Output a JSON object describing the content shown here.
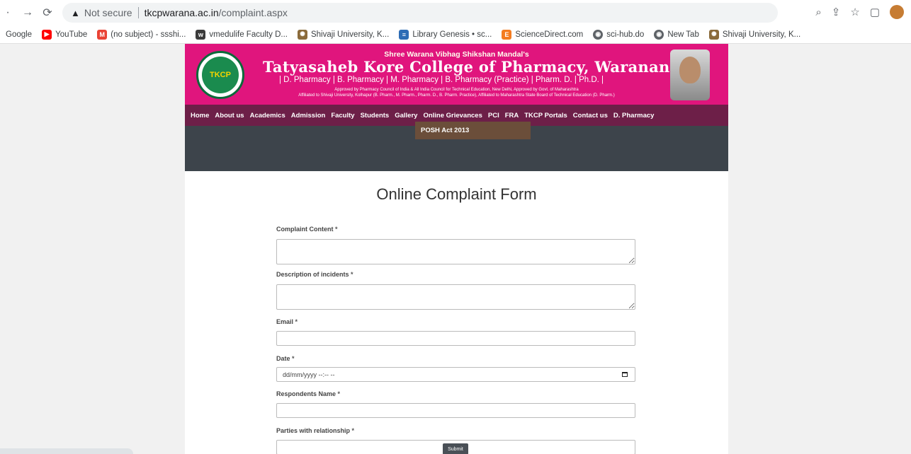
{
  "browser": {
    "not_secure": "Not secure",
    "url_host": "tkcpwarana.ac.in",
    "url_path": "/complaint.aspx"
  },
  "bookmarks": [
    {
      "label": "Google",
      "icon": "google-icon",
      "color": "#4285f4"
    },
    {
      "label": "YouTube",
      "icon": "youtube-icon",
      "color": "#ff0000"
    },
    {
      "label": "(no subject) - ssshi...",
      "icon": "gmail-icon",
      "color": "#ea4335"
    },
    {
      "label": "vmedulife Faculty D...",
      "icon": "vmedulife-icon",
      "color": "#3b3b3b"
    },
    {
      "label": "Shivaji University, K...",
      "icon": "university-icon",
      "color": "#8b6b3b"
    },
    {
      "label": "Library Genesis • sc...",
      "icon": "library-icon",
      "color": "#2d6cb5"
    },
    {
      "label": "ScienceDirect.com",
      "icon": "sciencedirect-icon",
      "color": "#f47c20"
    },
    {
      "label": "sci-hub.do",
      "icon": "globe-icon",
      "color": "#5f6368"
    },
    {
      "label": "New Tab",
      "icon": "globe-icon",
      "color": "#5f6368"
    },
    {
      "label": "Shivaji University, K...",
      "icon": "university-icon",
      "color": "#8b6b3b"
    }
  ],
  "header": {
    "top_line": "Shree Warana Vibhag Shikshan Mandal's",
    "title": "Tatyasaheb Kore College of Pharmacy, Warananagar",
    "courses": "| D. Pharmacy | B. Pharmacy | M. Pharmacy | B. Pharmacy (Practice) | Pharm. D. | Ph.D. |",
    "approved_1": "Approved by Pharmacy Council of India & All India Council for Technical Education, New Delhi, Approved by Govt. of Maharashtra",
    "approved_2": "Affiliated to Shivaji University, Kolhapur (B. Pharm., M. Pharm., Pharm. D., B. Pharm. Practice), Affiliated to Maharashtra State Board of Technical Education (D. Pharm.)",
    "logo_text": "TKCP",
    "logo_sub": "Warananagar"
  },
  "menu": [
    "Home",
    "About us",
    "Academics",
    "Admission",
    "Faculty",
    "Students",
    "Gallery",
    "Online Grievances",
    "PCI",
    "FRA",
    "TKCP Portals",
    "Contact us",
    "D. Pharmacy"
  ],
  "dropdown_item": "POSH Act 2013",
  "form": {
    "title": "Online Complaint Form",
    "complaint_content": "Complaint Content",
    "description": "Description of incidents",
    "email": "Email",
    "date": "Date",
    "date_placeholder": "dd/mm/yyyy --:-- --",
    "respondents": "Respondents Name",
    "parties": "Parties with relationship",
    "required_mark": "*",
    "submit": "Submit"
  },
  "colors": {
    "header": "#e0157d",
    "menu": "#6d1f48",
    "banner": "#3d444b"
  }
}
